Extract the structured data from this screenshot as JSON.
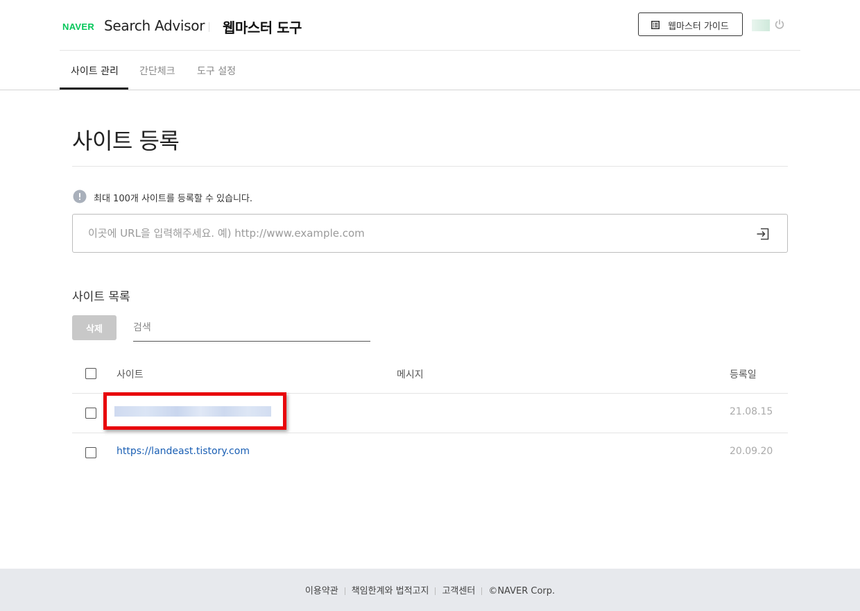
{
  "header": {
    "brand": "NAVER",
    "product": "Search Advisor",
    "tool_title": "웹마스터 도구",
    "guide_button": "웹마스터 가이드"
  },
  "tabs": [
    {
      "label": "사이트 관리",
      "active": true
    },
    {
      "label": "간단체크",
      "active": false
    },
    {
      "label": "도구 설정",
      "active": false
    }
  ],
  "main": {
    "page_title": "사이트 등록",
    "notice": "최대 100개 사이트를 등록할 수 있습니다.",
    "url_input": {
      "value": "",
      "placeholder": "이곳에 URL을 입력해주세요. 예) http://www.example.com"
    }
  },
  "site_list": {
    "title": "사이트 목록",
    "delete_button": "삭제",
    "search": {
      "value": "",
      "placeholder": "검색"
    },
    "columns": [
      "사이트",
      "메시지",
      "등록일"
    ],
    "rows": [
      {
        "site": "",
        "message": "",
        "date": "21.08.15"
      },
      {
        "site": "https://landeast.tistory.com",
        "message": "",
        "date": "20.09.20"
      }
    ]
  },
  "footer": {
    "links": [
      "이용약관",
      "책임한계와 법적고지",
      "고객센터"
    ],
    "copyright": "©NAVER Corp."
  },
  "colors": {
    "brand_green": "#03c75a",
    "link_blue": "#1a5fb4",
    "highlight_red": "#e8060c",
    "footer_bg": "#e7e9ed"
  },
  "icons": [
    "guide-list-icon",
    "power-icon",
    "info-icon",
    "submit-arrow-icon"
  ]
}
